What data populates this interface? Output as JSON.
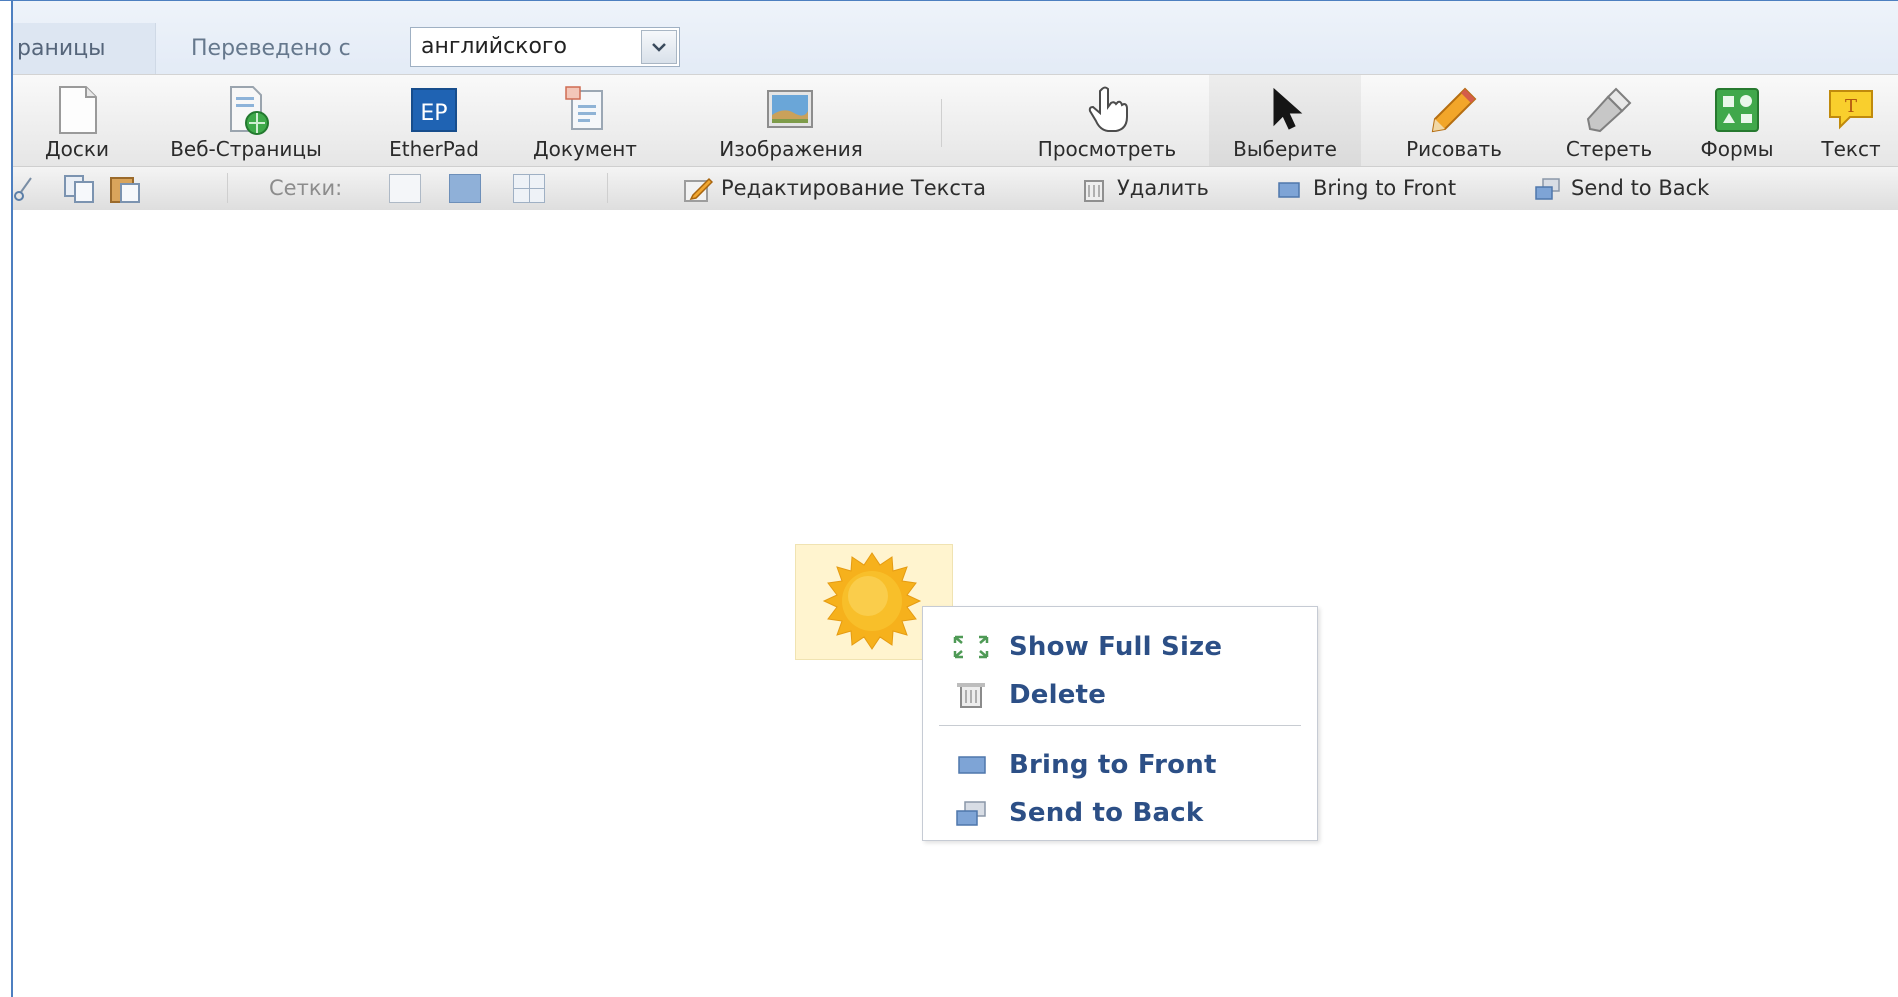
{
  "colors": {
    "accent_border": "#4d7fc0",
    "menu_text": "#2c4f86",
    "sun": "#f8b81c",
    "sun_background": "#fff4cf"
  },
  "tabbar": {
    "tab_label": "раницы",
    "translated_from_label": "Переведено с",
    "language_select_value": "английского"
  },
  "toolbar": {
    "items": [
      {
        "label": "Доски",
        "icon": "page-icon"
      },
      {
        "label": "Веб-Страницы",
        "icon": "web-page-icon"
      },
      {
        "label": "EtherPad",
        "icon": "etherpad-icon",
        "icon_text": "EP"
      },
      {
        "label": "Документ",
        "icon": "document-icon"
      },
      {
        "label": "Изображения",
        "icon": "image-icon"
      },
      {
        "label": "Просмотреть",
        "icon": "hand-pointer-icon"
      },
      {
        "label": "Выберите",
        "icon": "arrow-cursor-icon",
        "active": true
      },
      {
        "label": "Рисовать",
        "icon": "pencil-icon"
      },
      {
        "label": "Стереть",
        "icon": "eraser-icon"
      },
      {
        "label": "Формы",
        "icon": "shapes-icon"
      },
      {
        "label": "Текст",
        "icon": "text-bubble-icon",
        "icon_text": "T"
      }
    ]
  },
  "toolbar2": {
    "grids_label": "Сетки:",
    "edit_text": "Редактирование Текста",
    "delete": "Удалить",
    "bring_to_front": "Bring to Front",
    "send_to_back": "Send to Back"
  },
  "context_menu": {
    "items": [
      {
        "label": "Show Full Size",
        "icon": "expand-arrows-icon"
      },
      {
        "label": "Delete",
        "icon": "delete-icon"
      },
      {
        "label": "Bring to Front",
        "icon": "bring-front-icon"
      },
      {
        "label": "Send to Back",
        "icon": "send-back-icon"
      }
    ]
  }
}
